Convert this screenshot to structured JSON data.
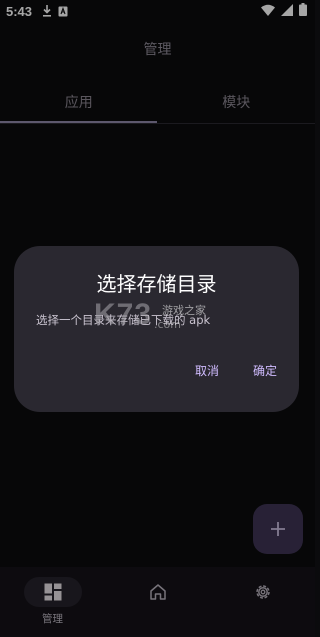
{
  "status_bar": {
    "time": "5:43"
  },
  "top_bar": {
    "title": "管理"
  },
  "tabs": [
    {
      "label": "应用",
      "active": true
    },
    {
      "label": "模块",
      "active": false
    }
  ],
  "dialog": {
    "title": "选择存储目录",
    "body": "选择一个目录来存储已下载的 apk",
    "cancel_label": "取消",
    "confirm_label": "确定"
  },
  "watermark": {
    "brand": "K73",
    "tagline": "游戏之家",
    "domain": ".com"
  },
  "fab": {
    "icon": "plus-icon"
  },
  "bottom_nav": {
    "items": [
      {
        "label": "管理",
        "icon": "dashboard-icon",
        "active": true
      },
      {
        "label": "",
        "icon": "home-icon",
        "active": false
      },
      {
        "label": "",
        "icon": "settings-icon",
        "active": false
      }
    ]
  },
  "colors": {
    "background": "#0b0b0d",
    "dialog": "#2a2830",
    "accent": "#d0bcff",
    "fab": "#3e3454"
  }
}
